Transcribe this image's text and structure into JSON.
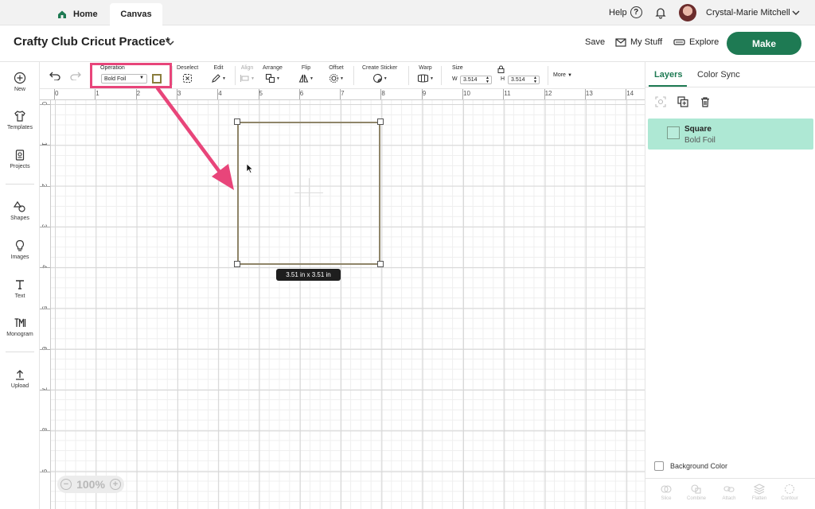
{
  "topbar": {
    "home_label": "Home",
    "canvas_label": "Canvas",
    "help_label": "Help",
    "user_name": "Crystal-Marie Mitchell"
  },
  "header": {
    "project_title": "Crafty Club Cricut Practice*",
    "save_label": "Save",
    "mystuff_label": "My Stuff",
    "explore_label": "Explore",
    "make_label": "Make"
  },
  "leftnav": {
    "items": [
      {
        "label": "New",
        "icon": "plus-circle-icon"
      },
      {
        "label": "Templates",
        "icon": "shirt-icon"
      },
      {
        "label": "Projects",
        "icon": "projects-icon"
      },
      {
        "label": "Shapes",
        "icon": "shapes-icon"
      },
      {
        "label": "Images",
        "icon": "lightbulb-icon"
      },
      {
        "label": "Text",
        "icon": "text-icon"
      },
      {
        "label": "Monogram",
        "icon": "monogram-icon"
      },
      {
        "label": "Upload",
        "icon": "upload-icon"
      }
    ]
  },
  "toolbar": {
    "operation_label": "Operation",
    "operation_value": "Bold Foil",
    "deselect_label": "Deselect",
    "edit_label": "Edit",
    "align_label": "Align",
    "arrange_label": "Arrange",
    "flip_label": "Flip",
    "offset_label": "Offset",
    "sticker_label": "Create Sticker",
    "warp_label": "Warp",
    "size_label": "Size",
    "w_label": "W",
    "w_value": "3.514",
    "h_label": "H",
    "h_value": "3.514",
    "more_label": "More"
  },
  "rulers": {
    "top": [
      "0",
      "1",
      "2",
      "3",
      "4",
      "5",
      "6",
      "7",
      "8",
      "9",
      "10",
      "11",
      "12",
      "13",
      "14"
    ],
    "left": [
      "0",
      "1",
      "2",
      "3",
      "4",
      "5",
      "6",
      "7",
      "8",
      "9"
    ]
  },
  "canvas": {
    "dimension_label": "3.51  in x 3.51  in",
    "zoom_label": "100%"
  },
  "rightpanel": {
    "tab_layers": "Layers",
    "tab_colorsync": "Color Sync",
    "layer_name": "Square",
    "layer_operation": "Bold Foil",
    "bg_color_label": "Background Color",
    "bottom_tools": [
      "Slice",
      "Combine",
      "Attach",
      "Flatten",
      "Contour"
    ]
  },
  "colors": {
    "accent": "#1e7a53",
    "highlight": "#e8457a",
    "selected_layer": "#aee8d4",
    "foil_gold": "#8a7d3d"
  }
}
